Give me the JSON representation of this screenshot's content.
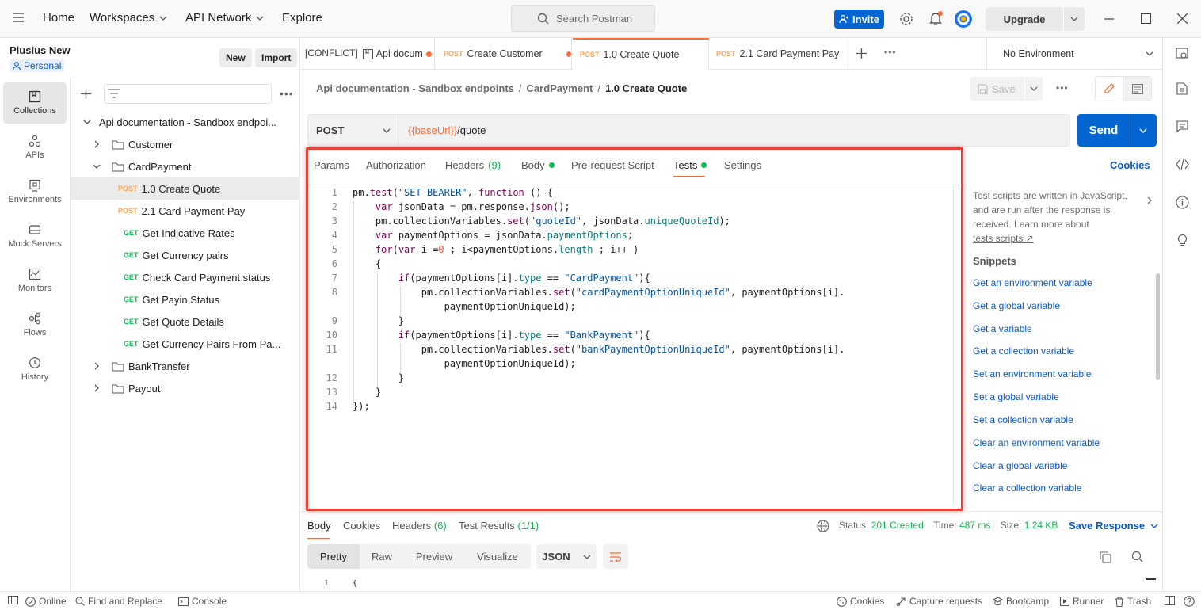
{
  "topbar": {
    "home": "Home",
    "workspaces": "Workspaces",
    "api_network": "API Network",
    "explore": "Explore",
    "search_placeholder": "Search Postman",
    "invite": "Invite",
    "upgrade": "Upgrade"
  },
  "workspace": {
    "name": "Plusius New",
    "type": "Personal",
    "new_btn": "New",
    "import_btn": "Import"
  },
  "rail": [
    {
      "label": "Collections",
      "icon": "collections-icon"
    },
    {
      "label": "APIs",
      "icon": "apis-icon"
    },
    {
      "label": "Environments",
      "icon": "environments-icon"
    },
    {
      "label": "Mock Servers",
      "icon": "mock-servers-icon"
    },
    {
      "label": "Monitors",
      "icon": "monitors-icon"
    },
    {
      "label": "Flows",
      "icon": "flows-icon"
    },
    {
      "label": "History",
      "icon": "history-icon"
    }
  ],
  "tree": {
    "collection": "Api documentation - Sandbox endpoi...",
    "folders": [
      "Customer",
      "CardPayment",
      "BankTransfer",
      "Payout"
    ],
    "requests": [
      {
        "method": "POST",
        "name": "1.0 Create Quote"
      },
      {
        "method": "POST",
        "name": "2.1 Card Payment Pay"
      },
      {
        "method": "GET",
        "name": "Get Indicative Rates"
      },
      {
        "method": "GET",
        "name": "Get Currency pairs"
      },
      {
        "method": "GET",
        "name": "Check Card Payment status"
      },
      {
        "method": "GET",
        "name": "Get Payin Status"
      },
      {
        "method": "GET",
        "name": "Get Quote Details"
      },
      {
        "method": "GET",
        "name": "Get Currency Pairs From Pa..."
      }
    ]
  },
  "tabs": {
    "conflict": "[CONFLICT]",
    "t1": "Api docum",
    "t2_method": "POST",
    "t2": "Create Customer",
    "t3_method": "POST",
    "t3": "1.0 Create Quote",
    "t4_method": "POST",
    "t4": "2.1 Card Payment Pay",
    "environment": "No Environment"
  },
  "breadcrumb": {
    "a": "Api documentation - Sandbox endpoints",
    "sep": "/",
    "b": "CardPayment",
    "c": "1.0 Create Quote",
    "save": "Save"
  },
  "request": {
    "method": "POST",
    "url_var": "{{baseUrl}}",
    "url_path": "/quote",
    "send": "Send"
  },
  "subtabs": {
    "params": "Params",
    "authorization": "Authorization",
    "headers": "Headers",
    "headers_count": "(9)",
    "body": "Body",
    "prerequest": "Pre-request Script",
    "tests": "Tests",
    "settings": "Settings",
    "cookies": "Cookies"
  },
  "code_lines": [
    "1",
    "2",
    "3",
    "4",
    "5",
    "6",
    "7",
    "8",
    "",
    "9",
    "10",
    "11",
    "",
    "12",
    "13",
    "14"
  ],
  "help": {
    "desc1": "Test scripts are written in JavaScript,",
    "desc2": "and are run after the response is",
    "desc3": "received. Learn more about",
    "link": "tests scripts ↗",
    "snippets_title": "Snippets",
    "snippets": [
      "Get an environment variable",
      "Get a global variable",
      "Get a variable",
      "Get a collection variable",
      "Set an environment variable",
      "Set a global variable",
      "Set a collection variable",
      "Clear an environment variable",
      "Clear a global variable",
      "Clear a collection variable"
    ]
  },
  "response": {
    "body": "Body",
    "cookies": "Cookies",
    "headers": "Headers",
    "headers_count": "(6)",
    "test_results": "Test Results",
    "test_count": "(1/1)",
    "status_label": "Status:",
    "status": "201 Created",
    "time_label": "Time:",
    "time": "487 ms",
    "size_label": "Size:",
    "size": "1.24 KB",
    "save": "Save Response",
    "pretty": "Pretty",
    "raw": "Raw",
    "preview": "Preview",
    "visualize": "Visualize",
    "format": "JSON",
    "first_line_no": "1",
    "first_line": "{"
  },
  "statusbar": {
    "online": "Online",
    "find": "Find and Replace",
    "console": "Console",
    "cookies": "Cookies",
    "capture": "Capture requests",
    "bootcamp": "Bootcamp",
    "runner": "Runner",
    "trash": "Trash"
  },
  "colors": {
    "accent": "#ff6c37",
    "primary": "#0265d2",
    "success": "#0cbb52",
    "highlight": "#e2453a"
  }
}
